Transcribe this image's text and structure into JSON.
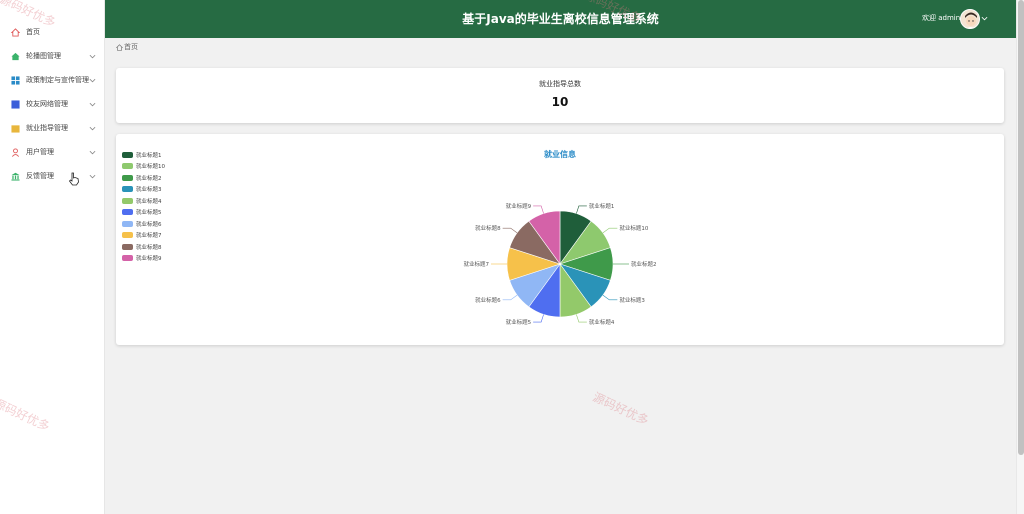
{
  "header": {
    "title": "基于Java的毕业生离校信息管理系统",
    "welcome": "欢迎 admin",
    "bg_color": "#266b43"
  },
  "sidebar": {
    "items": [
      {
        "label": "首页",
        "icon": "home-icon",
        "icon_color": "#e05a5a",
        "has_arrow": false
      },
      {
        "label": "轮播图管理",
        "icon": "house-icon",
        "icon_color": "#3bb36b",
        "has_arrow": true
      },
      {
        "label": "政策制定与宣传管理",
        "icon": "grid-icon",
        "icon_color": "#2a8bc7",
        "has_arrow": true
      },
      {
        "label": "校友网络管理",
        "icon": "square-icon",
        "icon_color": "#3c5fd9",
        "has_arrow": true
      },
      {
        "label": "就业指导管理",
        "icon": "folder-icon",
        "icon_color": "#e8b63c",
        "has_arrow": true
      },
      {
        "label": "用户管理",
        "icon": "user-icon",
        "icon_color": "#e05a5a",
        "has_arrow": true
      },
      {
        "label": "反馈管理",
        "icon": "bank-icon",
        "icon_color": "#3bb36b",
        "has_arrow": true
      }
    ]
  },
  "breadcrumb": {
    "home_label": "首页"
  },
  "stat": {
    "label": "就业指导总数",
    "value": "10"
  },
  "watermark": "源码好优多",
  "chart_data": {
    "type": "pie",
    "title": "就业信息",
    "legend_position": "top-left",
    "categories": [
      "就业标题1",
      "就业标题10",
      "就业标题2",
      "就业标题3",
      "就业标题4",
      "就业标题5",
      "就业标题6",
      "就业标题7",
      "就业标题8",
      "就业标题9"
    ],
    "values": [
      1,
      1,
      1,
      1,
      1,
      1,
      1,
      1,
      1,
      1
    ],
    "colors": [
      "#1f5e3a",
      "#8ec96e",
      "#3f9a4a",
      "#2a93b8",
      "#93c96a",
      "#4f6ef0",
      "#90b7f5",
      "#f6c14a",
      "#8a6a62",
      "#d462a8"
    ]
  }
}
